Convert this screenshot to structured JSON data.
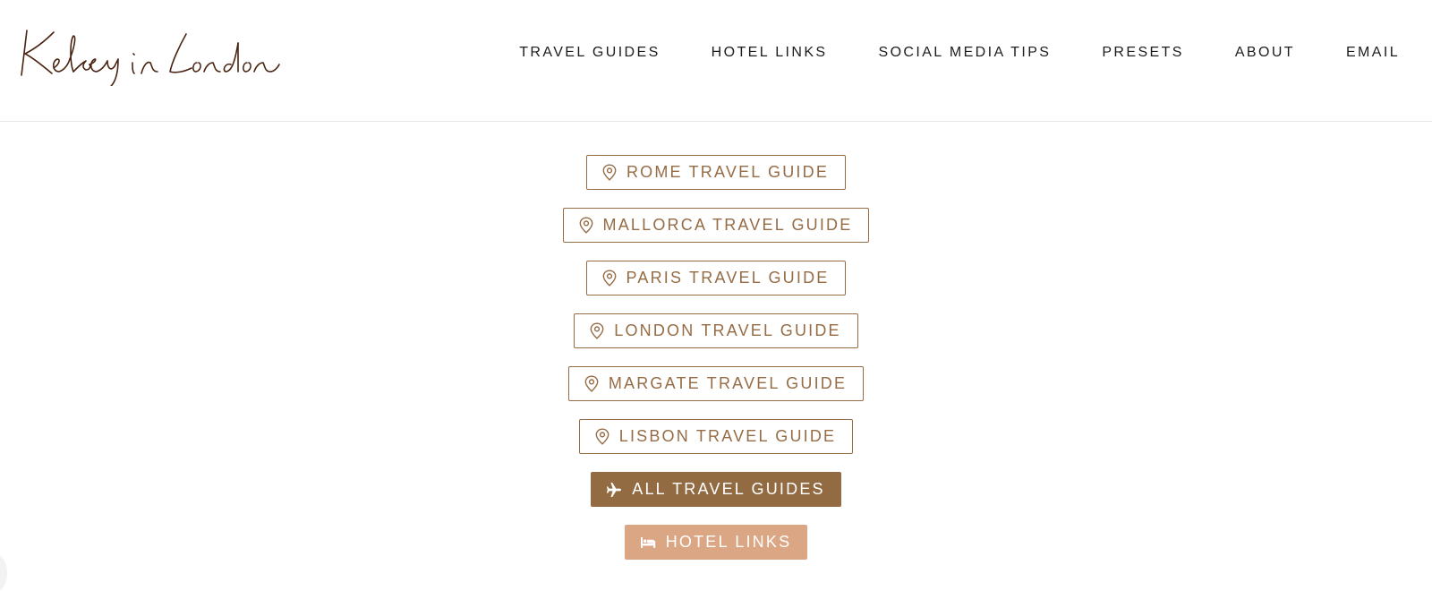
{
  "header": {
    "logo_text": "Kelsey in London",
    "nav": [
      {
        "label": "TRAVEL GUIDES"
      },
      {
        "label": "HOTEL LINKS"
      },
      {
        "label": "SOCIAL MEDIA TIPS"
      },
      {
        "label": "PRESETS"
      },
      {
        "label": "ABOUT"
      },
      {
        "label": "EMAIL"
      }
    ]
  },
  "main": {
    "buttons": [
      {
        "label": "ROME TRAVEL GUIDE",
        "icon": "map-pin-icon"
      },
      {
        "label": "MALLORCA TRAVEL GUIDE",
        "icon": "map-pin-icon"
      },
      {
        "label": "PARIS TRAVEL GUIDE",
        "icon": "map-pin-icon"
      },
      {
        "label": "LONDON TRAVEL GUIDE",
        "icon": "map-pin-icon"
      },
      {
        "label": "MARGATE TRAVEL GUIDE",
        "icon": "map-pin-icon"
      },
      {
        "label": "LISBON TRAVEL GUIDE",
        "icon": "map-pin-icon"
      },
      {
        "label": "ALL TRAVEL GUIDES",
        "icon": "airplane-icon"
      },
      {
        "label": "HOTEL LINKS",
        "icon": "bed-icon"
      }
    ]
  },
  "colors": {
    "brand_brown": "#966c45",
    "dark_button": "#936b43",
    "light_button": "#dba684",
    "logo": "#4a2412",
    "nav_text": "#1d1d1d"
  }
}
